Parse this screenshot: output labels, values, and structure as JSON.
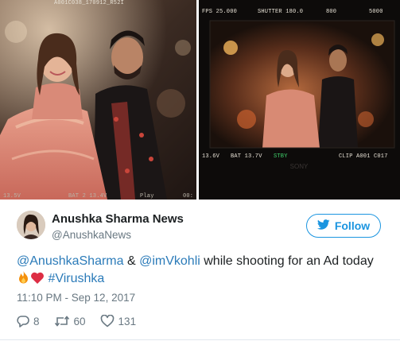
{
  "media": {
    "left_photo": {
      "top_hud": "A001C038_170912_R52I",
      "bottom_hud": [
        "13.5V",
        "BAT 2 13.4V",
        "Play",
        "00:"
      ]
    },
    "right_photo": {
      "top_hud": [
        "FPS 25.000",
        "SHUTTER 180.0",
        "800",
        "5000"
      ],
      "bottom_hud": [
        "13.6V",
        "BAT 13.7V",
        "STBY",
        "CLIP A001 C017"
      ],
      "watermark": "SONY"
    }
  },
  "tweet": {
    "display_name": "Anushka Sharma News",
    "handle": "@AnushkaNews",
    "follow_label": "Follow",
    "text": {
      "mention_1": "@AnushkaSharma",
      "amp": " & ",
      "mention_2": "@imVkohli",
      "rest": " while shooting for an Ad today",
      "hashtag": "#Virushka"
    },
    "timestamp": "11:10 PM - Sep 12, 2017",
    "actions": {
      "replies": "8",
      "retweets": "60",
      "likes": "131"
    }
  },
  "colors": {
    "link_blue": "#2b7bb9",
    "follow_blue": "#1b95e0",
    "secondary_text": "#697882",
    "heart_red": "#e0245e",
    "fire_orange": "#f4900c"
  }
}
